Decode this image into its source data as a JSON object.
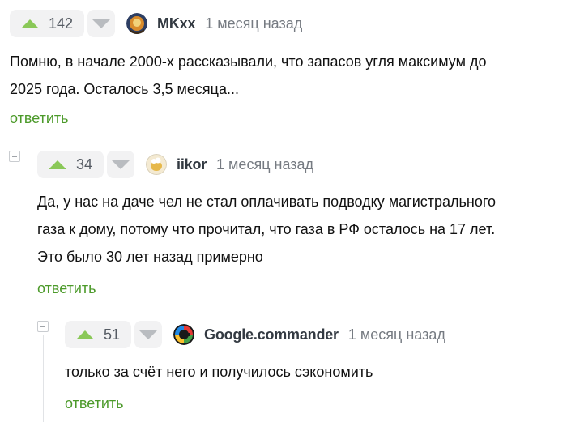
{
  "comments": [
    {
      "votes": "142",
      "author": "MKxx",
      "time": "1 месяц назад",
      "text_lines": [
        "Помню, в начале 2000-х рассказывали, что запасов угля максимум до",
        "2025 года. Осталось 3,5 месяца..."
      ],
      "reply_label": "ответить"
    },
    {
      "votes": "34",
      "author": "iikor",
      "time": "1 месяц назад",
      "text_lines": [
        "Да, у нас на даче чел не стал оплачивать подводку магистрального",
        "газа к дому, потому что прочитал, что газа в РФ осталось на 17 лет.",
        "Это было 30 лет назад примерно"
      ],
      "reply_label": "ответить"
    },
    {
      "votes": "51",
      "author": "Google.commander",
      "time": "1 месяц назад",
      "text_lines": [
        "только за счёт него и получилось сэкономить"
      ],
      "reply_label": "ответить"
    }
  ],
  "colors": {
    "upvote": "#8ac858",
    "downvote": "#b9bcc0",
    "reply": "#4c9a2a",
    "time": "#767b82"
  }
}
